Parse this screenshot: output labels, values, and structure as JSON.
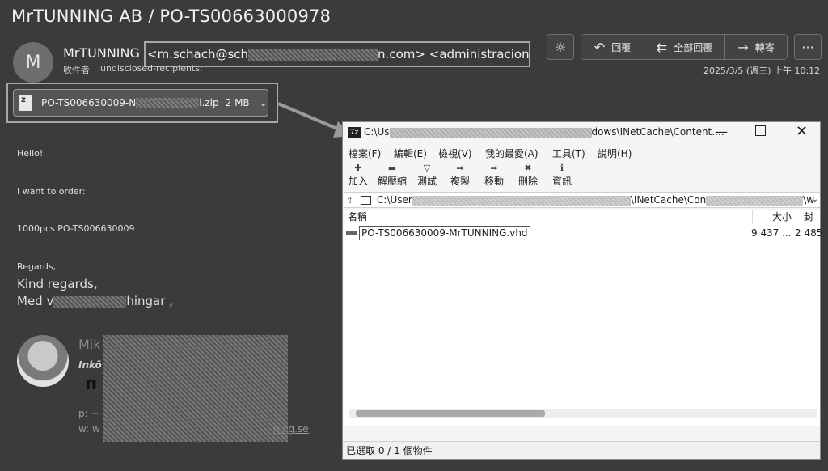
{
  "email": {
    "subject": "MrTUNNING AB / PO-TS00663000978",
    "avatar_letter": "M",
    "sender_name": "MrTUNNING",
    "from_addr_start": "<m.schach@sch",
    "from_addr_end": "n.com> <administracion@tech",
    "recipients_label": "收件者",
    "recipients_value": "undisclosed-recipients:",
    "date": "2025/3/5 (週三) 上午 10:12"
  },
  "toolbar": {
    "reply_label": "回覆",
    "reply_all_label": "全部回覆",
    "forward_label": "轉寄",
    "more_label": "···"
  },
  "attachment": {
    "name_start": "PO-TS006630009-N",
    "name_end": "i.zip",
    "size": "2 MB"
  },
  "body": {
    "greeting": "Hello!",
    "line1": "I want to order:",
    "line2": "1000pcs PO-TS006630009",
    "regards1": "Regards,",
    "regards2": "Kind regards,",
    "regards3_start": "Med v",
    "regards3_end": "hingar ,"
  },
  "signature": {
    "name_start": "Mik",
    "title_start": "Inkö",
    "logo_start": "п",
    "phone_label": "p:",
    "phone_start": "+",
    "web_label": "w:",
    "web_start": "w",
    "web_end": "ning.se"
  },
  "sevenzip": {
    "title_start": "C:\\Us",
    "title_end": "dows\\INetCache\\Content....",
    "menu": [
      "檔案(F)",
      "編輯(E)",
      "檢視(V)",
      "我的最愛(A)",
      "工具(T)",
      "說明(H)"
    ],
    "tools": [
      {
        "icon": "✚",
        "label": "加入"
      },
      {
        "icon": "▬",
        "label": "解壓縮"
      },
      {
        "icon": "▽",
        "label": "測試"
      },
      {
        "icon": "➡",
        "label": "複製"
      },
      {
        "icon": "➡",
        "label": "移動"
      },
      {
        "icon": "✖",
        "label": "刪除"
      },
      {
        "icon": "ℹ",
        "label": "資訊"
      }
    ],
    "path_start": "C:\\User",
    "path_end": "\\INetCache\\Con",
    "path_tail": "\\w",
    "col_name": "名稱",
    "col_size": "大小",
    "col_packed": "封裝",
    "file_name": "PO-TS006630009-MrTUNNING.vhd",
    "file_size": "9 437 ...",
    "file_packed": "2 485",
    "status": "已選取 0 / 1 個物件"
  }
}
